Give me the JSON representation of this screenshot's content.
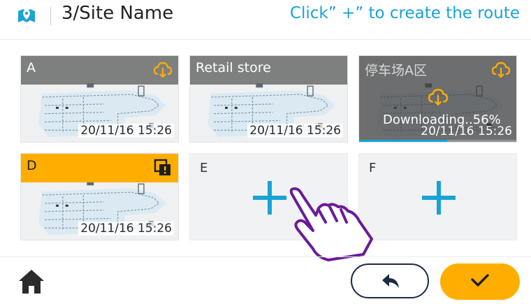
{
  "header": {
    "site_title": "3/Site Name",
    "hint": "Click” +” to create the route"
  },
  "routes": [
    {
      "label": "A",
      "timestamp": "20/11/16 15:26",
      "icon": "cloud-download-icon"
    },
    {
      "label": "Retail store",
      "timestamp": "20/11/16 15:26"
    },
    {
      "label": "停车场A区",
      "timestamp": "20/11/16 15:26",
      "status": "Downloading..56%",
      "progress": 0.56,
      "icon": "cloud-download-icon"
    },
    {
      "label": "D",
      "timestamp": "20/11/16 15:26",
      "icon": "alert-layers-icon",
      "selected": true
    },
    {
      "label": "E",
      "empty": true
    },
    {
      "label": "F",
      "empty": true
    }
  ],
  "colors": {
    "accent_blue": "#1aa3d6",
    "accent_yellow": "#ffae00",
    "overlay_purple": "#6a1b9a",
    "dark_navy": "#1b2a45"
  },
  "footer": {
    "home_icon": "home-icon",
    "back_icon": "back-arrow-icon",
    "confirm_icon": "checkmark-icon"
  }
}
